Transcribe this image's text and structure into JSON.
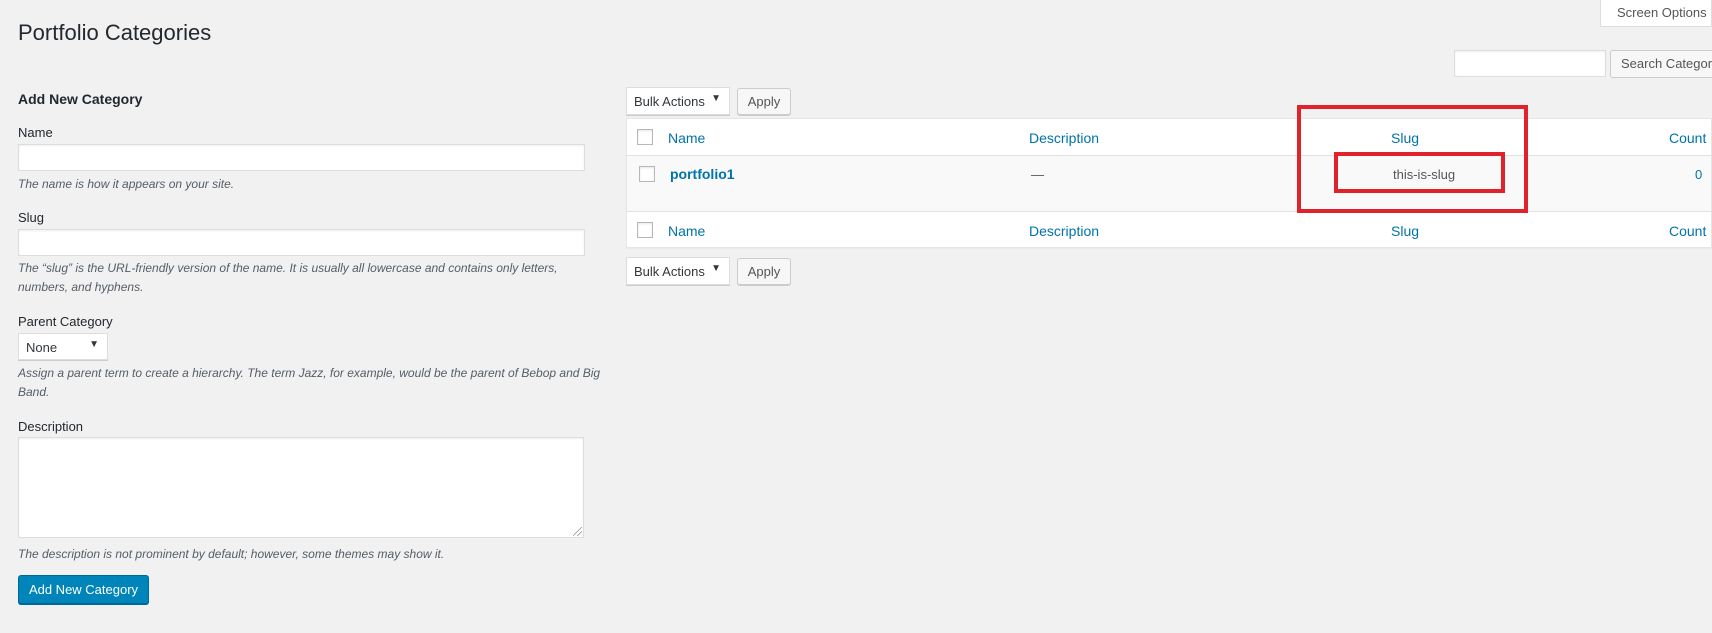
{
  "page": {
    "title": "Portfolio Categories"
  },
  "header": {
    "screen_options": "Screen Options",
    "search_placeholder": "",
    "search_button": "Search Categories"
  },
  "form": {
    "title": "Add New Category",
    "name_label": "Name",
    "name_hint": "The name is how it appears on your site.",
    "slug_label": "Slug",
    "slug_hint": "The “slug” is the URL-friendly version of the name. It is usually all lowercase and contains only letters, numbers, and hyphens.",
    "parent_label": "Parent Category",
    "parent_value": "None",
    "parent_hint": "Assign a parent term to create a hierarchy. The term Jazz, for example, would be the parent of Bebop and Big Band.",
    "description_label": "Description",
    "description_hint": "The description is not prominent by default; however, some themes may show it.",
    "submit": "Add New Category"
  },
  "bulk": {
    "top_select": "Bulk Actions",
    "top_apply": "Apply",
    "bottom_select": "Bulk Actions",
    "bottom_apply": "Apply"
  },
  "table": {
    "columns": [
      "Name",
      "Description",
      "Slug",
      "Count"
    ],
    "rows": [
      {
        "name": "portfolio1",
        "description": "—",
        "slug": "this-is-slug",
        "count": "0"
      }
    ]
  },
  "colors": {
    "link": "#0073aa",
    "primary": "#0085ba",
    "highlight": "#e0222d"
  }
}
